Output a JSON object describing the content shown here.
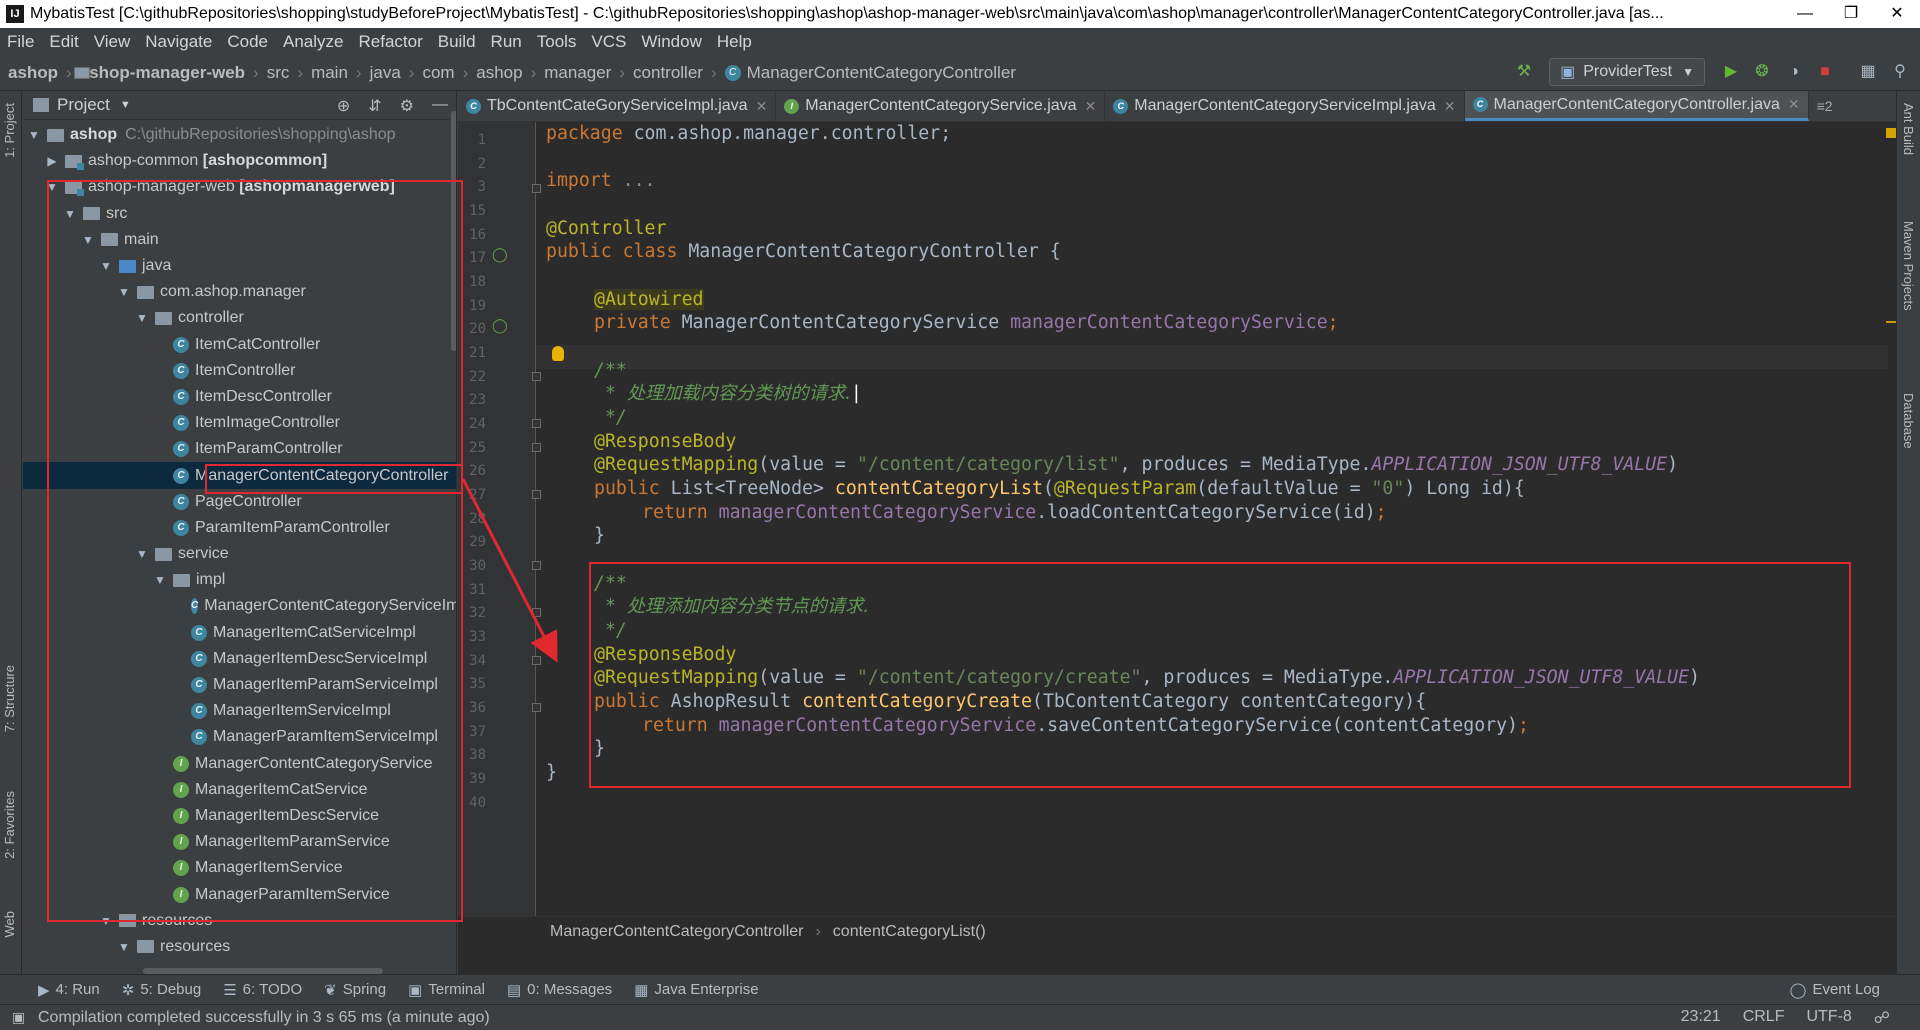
{
  "window": {
    "title": "MybatisTest [C:\\githubRepositories\\shopping\\studyBeforeProject\\MybatisTest] - C:\\githubRepositories\\shopping\\ashop\\ashop-manager-web\\src\\main\\java\\com\\ashop\\manager\\controller\\ManagerContentCategoryController.java [as...",
    "app_icon": "IJ"
  },
  "menu": [
    "File",
    "Edit",
    "View",
    "Navigate",
    "Code",
    "Analyze",
    "Refactor",
    "Build",
    "Run",
    "Tools",
    "VCS",
    "Window",
    "Help"
  ],
  "breadcrumbs": [
    "ashop",
    "ashop-manager-web",
    "src",
    "main",
    "java",
    "com",
    "ashop",
    "manager",
    "controller",
    "ManagerContentCategoryController"
  ],
  "run_config": "ProviderTest",
  "left_tabs": [
    "1: Project",
    "7: Structure",
    "2: Favorites",
    "Web"
  ],
  "right_tabs": [
    "Ant Build",
    "Maven Projects",
    "Database"
  ],
  "project_panel": {
    "title": "Project",
    "root_name": "ashop",
    "root_path": "C:\\githubRepositories\\shopping\\ashop",
    "nodes": [
      {
        "name": "ashop-common",
        "module": "[ashopcommon]"
      },
      {
        "name": "ashop-manager-web",
        "module": "[ashopmanagerweb]"
      },
      {
        "name": "src"
      },
      {
        "name": "main"
      },
      {
        "name": "java"
      },
      {
        "name": "com.ashop.manager"
      },
      {
        "name": "controller"
      },
      {
        "name": "ItemCatController"
      },
      {
        "name": "ItemController"
      },
      {
        "name": "ItemDescController"
      },
      {
        "name": "ItemImageController"
      },
      {
        "name": "ItemParamController"
      },
      {
        "name": "ManagerContentCategoryController"
      },
      {
        "name": "PageController"
      },
      {
        "name": "ParamItemParamController"
      },
      {
        "name": "service"
      },
      {
        "name": "impl"
      },
      {
        "name": "ManagerContentCategoryServiceImpl"
      },
      {
        "name": "ManagerItemCatServiceImpl"
      },
      {
        "name": "ManagerItemDescServiceImpl"
      },
      {
        "name": "ManagerItemParamServiceImpl"
      },
      {
        "name": "ManagerItemServiceImpl"
      },
      {
        "name": "ManagerParamItemServiceImpl"
      },
      {
        "name": "ManagerContentCategoryService"
      },
      {
        "name": "ManagerItemCatService"
      },
      {
        "name": "ManagerItemDescService"
      },
      {
        "name": "ManagerItemParamService"
      },
      {
        "name": "ManagerItemService"
      },
      {
        "name": "ManagerParamItemService"
      },
      {
        "name": "resources"
      },
      {
        "name": "resources"
      }
    ]
  },
  "editor_tabs": [
    {
      "label": "TbContentCateGoryServiceImpl.java",
      "kind": "C"
    },
    {
      "label": "ManagerContentCategoryService.java",
      "kind": "I"
    },
    {
      "label": "ManagerContentCategoryServiceImpl.java",
      "kind": "C"
    },
    {
      "label": "ManagerContentCategoryController.java",
      "kind": "C"
    }
  ],
  "tab_overflow": "≡2",
  "line_numbers": [
    "1",
    "2",
    "3",
    "15",
    "16",
    "17",
    "18",
    "19",
    "20",
    "21",
    "22",
    "23",
    "24",
    "25",
    "26",
    "27",
    "28",
    "29",
    "30",
    "31",
    "32",
    "33",
    "34",
    "35",
    "36",
    "37",
    "38",
    "39",
    "40"
  ],
  "code": {
    "l1_kw": "package",
    "l1_rest": " com.ashop.manager.controller;",
    "l3_kw": "import",
    "l3_rest": " ...",
    "l16": "@Controller",
    "l17_kw": "public class",
    "l17_rest": " ManagerContentCategoryController {",
    "l19": "@Autowired",
    "l20_kw": "private",
    "l20_type": " ManagerContentCategoryService ",
    "l20_field": "managerContentCategoryService",
    "l20_end": ";",
    "l22": "/**",
    "l23_star": " * ",
    "l23_text": "处理加载内容分类树的请求.",
    "l24": " */",
    "l25": "@ResponseBody",
    "l26_an": "@RequestMapping",
    "l26_a": "(value = ",
    "l26_str": "\"/content/category/list\"",
    "l26_b": ", produces = MediaType.",
    "l26_const": "APPLICATION_JSON_UTF8_VALUE",
    "l26_c": ")",
    "l27_kw": "public",
    "l27_a": " List<TreeNode> ",
    "l27_fn": "contentCategoryList",
    "l27_b": "(",
    "l27_an": "@RequestParam",
    "l27_c": "(defaultValue = ",
    "l27_str": "\"0\"",
    "l27_d": ") Long id){",
    "l28_kw": "return",
    "l28_field": " managerContentCategoryService",
    "l28_rest": ".loadContentCategoryService(id)",
    "l28_end": ";",
    "l29": "}",
    "l31": "/**",
    "l32_star": " * ",
    "l32_text": "处理添加内容分类节点的请求.",
    "l33": " */",
    "l34": "@ResponseBody",
    "l35_an": "@RequestMapping",
    "l35_a": "(value = ",
    "l35_str": "\"/content/category/create\"",
    "l35_b": ", produces = MediaType.",
    "l35_const": "APPLICATION_JSON_UTF8_VALUE",
    "l35_c": ")",
    "l36_kw": "public",
    "l36_a": " AshopResult ",
    "l36_fn": "contentCategoryCreate",
    "l36_b": "(TbContentCategory contentCategory){",
    "l37_kw": "return",
    "l37_field": " managerContentCategoryService",
    "l37_rest": ".saveContentCategoryService(contentCategory)",
    "l37_end": ";",
    "l38": "}",
    "l39": "}"
  },
  "editor_breadcrumb": {
    "class": "ManagerContentCategoryController",
    "method": "contentCategoryList()"
  },
  "tool_windows": [
    {
      "icon": "▶",
      "label": "4: Run"
    },
    {
      "icon": "✲",
      "label": "5: Debug"
    },
    {
      "icon": "☰",
      "label": "6: TODO"
    },
    {
      "icon": "❦",
      "label": "Spring"
    },
    {
      "icon": "▣",
      "label": "Terminal"
    },
    {
      "icon": "▤",
      "label": "0: Messages"
    },
    {
      "icon": "▦",
      "label": "Java Enterprise"
    }
  ],
  "event_log": "Event Log",
  "status": {
    "message": "Compilation completed successfully in 3 s 65 ms (a minute ago)",
    "position": "23:21",
    "line_sep": "CRLF",
    "encoding": "UTF-8"
  },
  "colors": {
    "highlight": "#e0282e",
    "keyword": "#cc7832",
    "annotation": "#bbb529",
    "string": "#6a8759"
  }
}
